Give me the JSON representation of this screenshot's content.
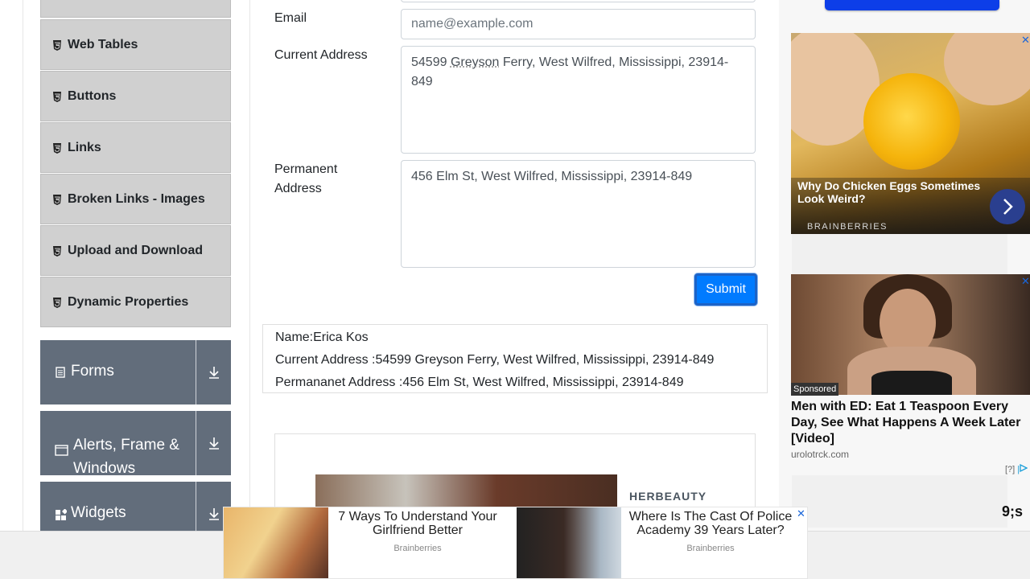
{
  "sidebar": {
    "items": [
      {
        "label": "Web Tables"
      },
      {
        "label": "Buttons"
      },
      {
        "label": "Links"
      },
      {
        "label": "Broken Links - Images"
      },
      {
        "label": "Upload and Download"
      },
      {
        "label": "Dynamic Properties"
      }
    ],
    "groups": [
      {
        "label": "Forms"
      },
      {
        "label": "Alerts, Frame & Windows"
      },
      {
        "label": "Widgets"
      }
    ]
  },
  "form": {
    "email_label": "Email",
    "email_placeholder": "name@example.com",
    "current_address_label": "Current Address",
    "current_address_value_a": "54599 ",
    "current_address_value_b": "Greyson",
    "current_address_value_c": " Ferry, West Wilfred, Mississippi, 23914-849",
    "permanent_address_label": "Permanent Address",
    "permanent_address_value": "456 Elm St, West Wilfred, Mississippi, 23914-849",
    "submit_label": "Submit"
  },
  "output": {
    "name": "Name:Erica Kos",
    "current_address": "Current Address :54599 Greyson Ferry, West Wilfred, Mississippi, 23914-849",
    "permanent_address": "Permananet Address :456 Elm St, West Wilfred, Mississippi, 23914-849"
  },
  "ads": {
    "ad1_title": "Why Do Chicken Eggs Sometimes Look Weird?",
    "ad1_brand": "BRAINBERRIES",
    "ad2_sponsored": "Sponsored",
    "ad2_title": "Men with ED: Eat 1 Teaspoon Every Day, See What Happens A Week Later [Video]",
    "ad2_domain": "urolotrck.com",
    "ad_info": "[?]",
    "close_glyph": "✕",
    "herbeauty": "HERBEAUTY",
    "bottom1_title": "7 Ways To Understand Your Girlfriend Better",
    "bottom1_source": "Brainberries",
    "bottom2_title": "Where Is The Cast Of Police Academy 39 Years Later?",
    "bottom2_source": "Brainberries",
    "partial_text": "9;s"
  },
  "colors": {
    "accent": "#007bff",
    "sidebar_group": "#626d7b",
    "sidebar_item": "#d0d0d0"
  }
}
